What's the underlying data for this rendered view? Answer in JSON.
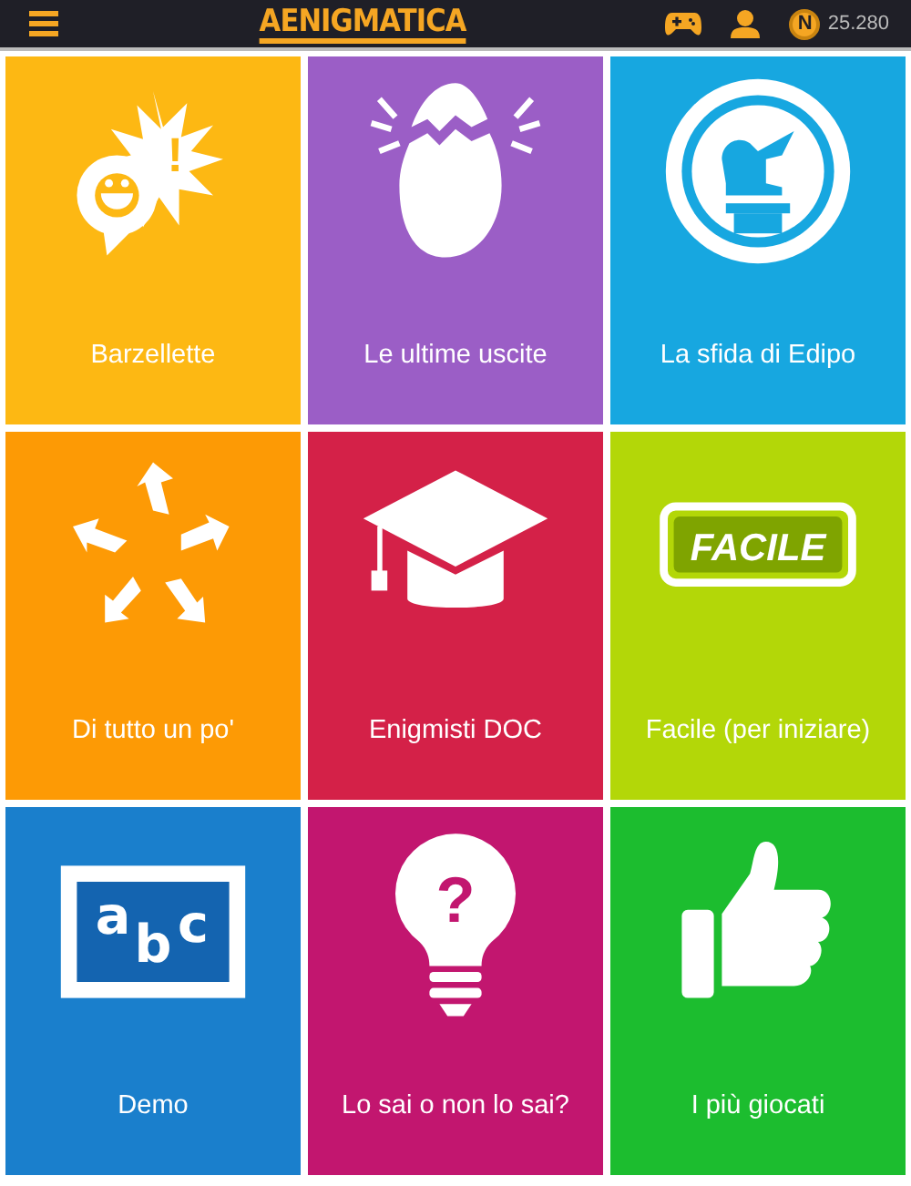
{
  "top_bar": {
    "logo": "AENIGMATICA",
    "coin_letter": "N",
    "score": "25.280"
  },
  "tiles": [
    {
      "kind": "joke",
      "label": "Barzellette",
      "color": "#fdb813",
      "icon_text": "!"
    },
    {
      "kind": "new",
      "label": "Le ultime uscite",
      "color": "#9b5ec6"
    },
    {
      "kind": "sphinx",
      "label": "La sfida di Edipo",
      "color": "#17a7e0"
    },
    {
      "kind": "mix",
      "label": "Di tutto un po'",
      "color": "#fd9a05"
    },
    {
      "kind": "doc",
      "label": "Enigmisti DOC",
      "color": "#d42148"
    },
    {
      "kind": "easy",
      "label": "Facile (per iniziare)",
      "color": "#b3d708",
      "icon_text": "FACILE"
    },
    {
      "kind": "demo",
      "label": "Demo",
      "color": "#1a7fcc",
      "icon_text": "abc"
    },
    {
      "kind": "quiz",
      "label": "Lo sai o non lo sai?",
      "color": "#c2166f",
      "icon_text": "?"
    },
    {
      "kind": "popular",
      "label": "I più giocati",
      "color": "#1cbd2f"
    }
  ]
}
